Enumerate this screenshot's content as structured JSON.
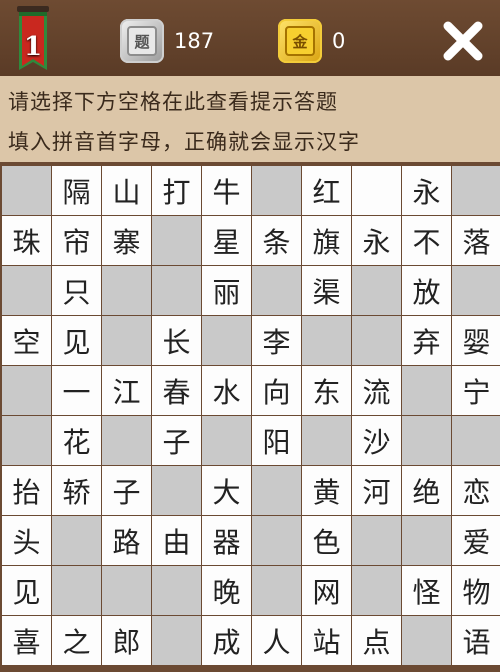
{
  "header": {
    "level": "1",
    "question_icon_char": "题",
    "question_count": "187",
    "gold_icon_char": "金",
    "gold_count": "0",
    "close_icon": "close-x-icon"
  },
  "hints": {
    "line1": "请选择下方空格在此查看提示答题",
    "line2": "填入拼音首字母，正确就会显示汉字"
  },
  "colors": {
    "background": "#6b4a33",
    "hint_bar": "#dcc6a8",
    "cell_white": "#fdfdfd",
    "cell_gray": "#c9c9c9"
  },
  "grid": {
    "rows": [
      [
        "#",
        "隔",
        "山",
        "打",
        "牛",
        "#",
        "红",
        "#",
        "永",
        "#"
      ],
      [
        "珠",
        "帘",
        "寨",
        "#",
        "星",
        "条",
        "旗",
        "永",
        "不",
        "落"
      ],
      [
        "#",
        "只",
        "#",
        "#",
        "丽",
        "#",
        "渠",
        "#",
        "放",
        "#"
      ],
      [
        "空",
        "见",
        "#",
        "长",
        "#",
        "李",
        "#",
        "#",
        "弃",
        "婴"
      ],
      [
        "#",
        "一",
        "江",
        "春",
        "水",
        "向",
        "东",
        "流",
        "#",
        "宁"
      ],
      [
        "#",
        "花",
        "#",
        "子",
        "#",
        "阳",
        "#",
        "沙",
        "#",
        "#"
      ],
      [
        "抬",
        "轿",
        "子",
        "#",
        "大",
        "#",
        "黄",
        "河",
        "绝",
        "恋"
      ],
      [
        "头",
        "#",
        "路",
        "由",
        "器",
        "#",
        "色",
        "#",
        "#",
        "爱"
      ],
      [
        "见",
        "#",
        "#",
        "#",
        "晚",
        "#",
        "网",
        "#",
        "怪",
        "物"
      ],
      [
        "喜",
        "之",
        "郎",
        "#",
        "成",
        "人",
        "站",
        "点",
        "#",
        "语"
      ]
    ],
    "blank_rows": [
      [
        1,
        0,
        0,
        0,
        0,
        1,
        0,
        0,
        0,
        1
      ],
      [
        0,
        0,
        0,
        1,
        0,
        0,
        0,
        0,
        0,
        0
      ],
      [
        1,
        0,
        1,
        1,
        0,
        1,
        0,
        1,
        0,
        1
      ],
      [
        0,
        0,
        1,
        0,
        1,
        0,
        1,
        1,
        0,
        0
      ],
      [
        1,
        0,
        0,
        0,
        0,
        0,
        0,
        0,
        1,
        0
      ],
      [
        1,
        0,
        1,
        0,
        1,
        0,
        1,
        0,
        1,
        1
      ],
      [
        0,
        0,
        0,
        1,
        0,
        1,
        0,
        0,
        0,
        0
      ],
      [
        0,
        1,
        0,
        0,
        0,
        1,
        0,
        1,
        1,
        0
      ],
      [
        0,
        1,
        1,
        1,
        0,
        1,
        0,
        1,
        0,
        0
      ],
      [
        0,
        0,
        0,
        1,
        0,
        0,
        0,
        0,
        1,
        0
      ]
    ]
  }
}
